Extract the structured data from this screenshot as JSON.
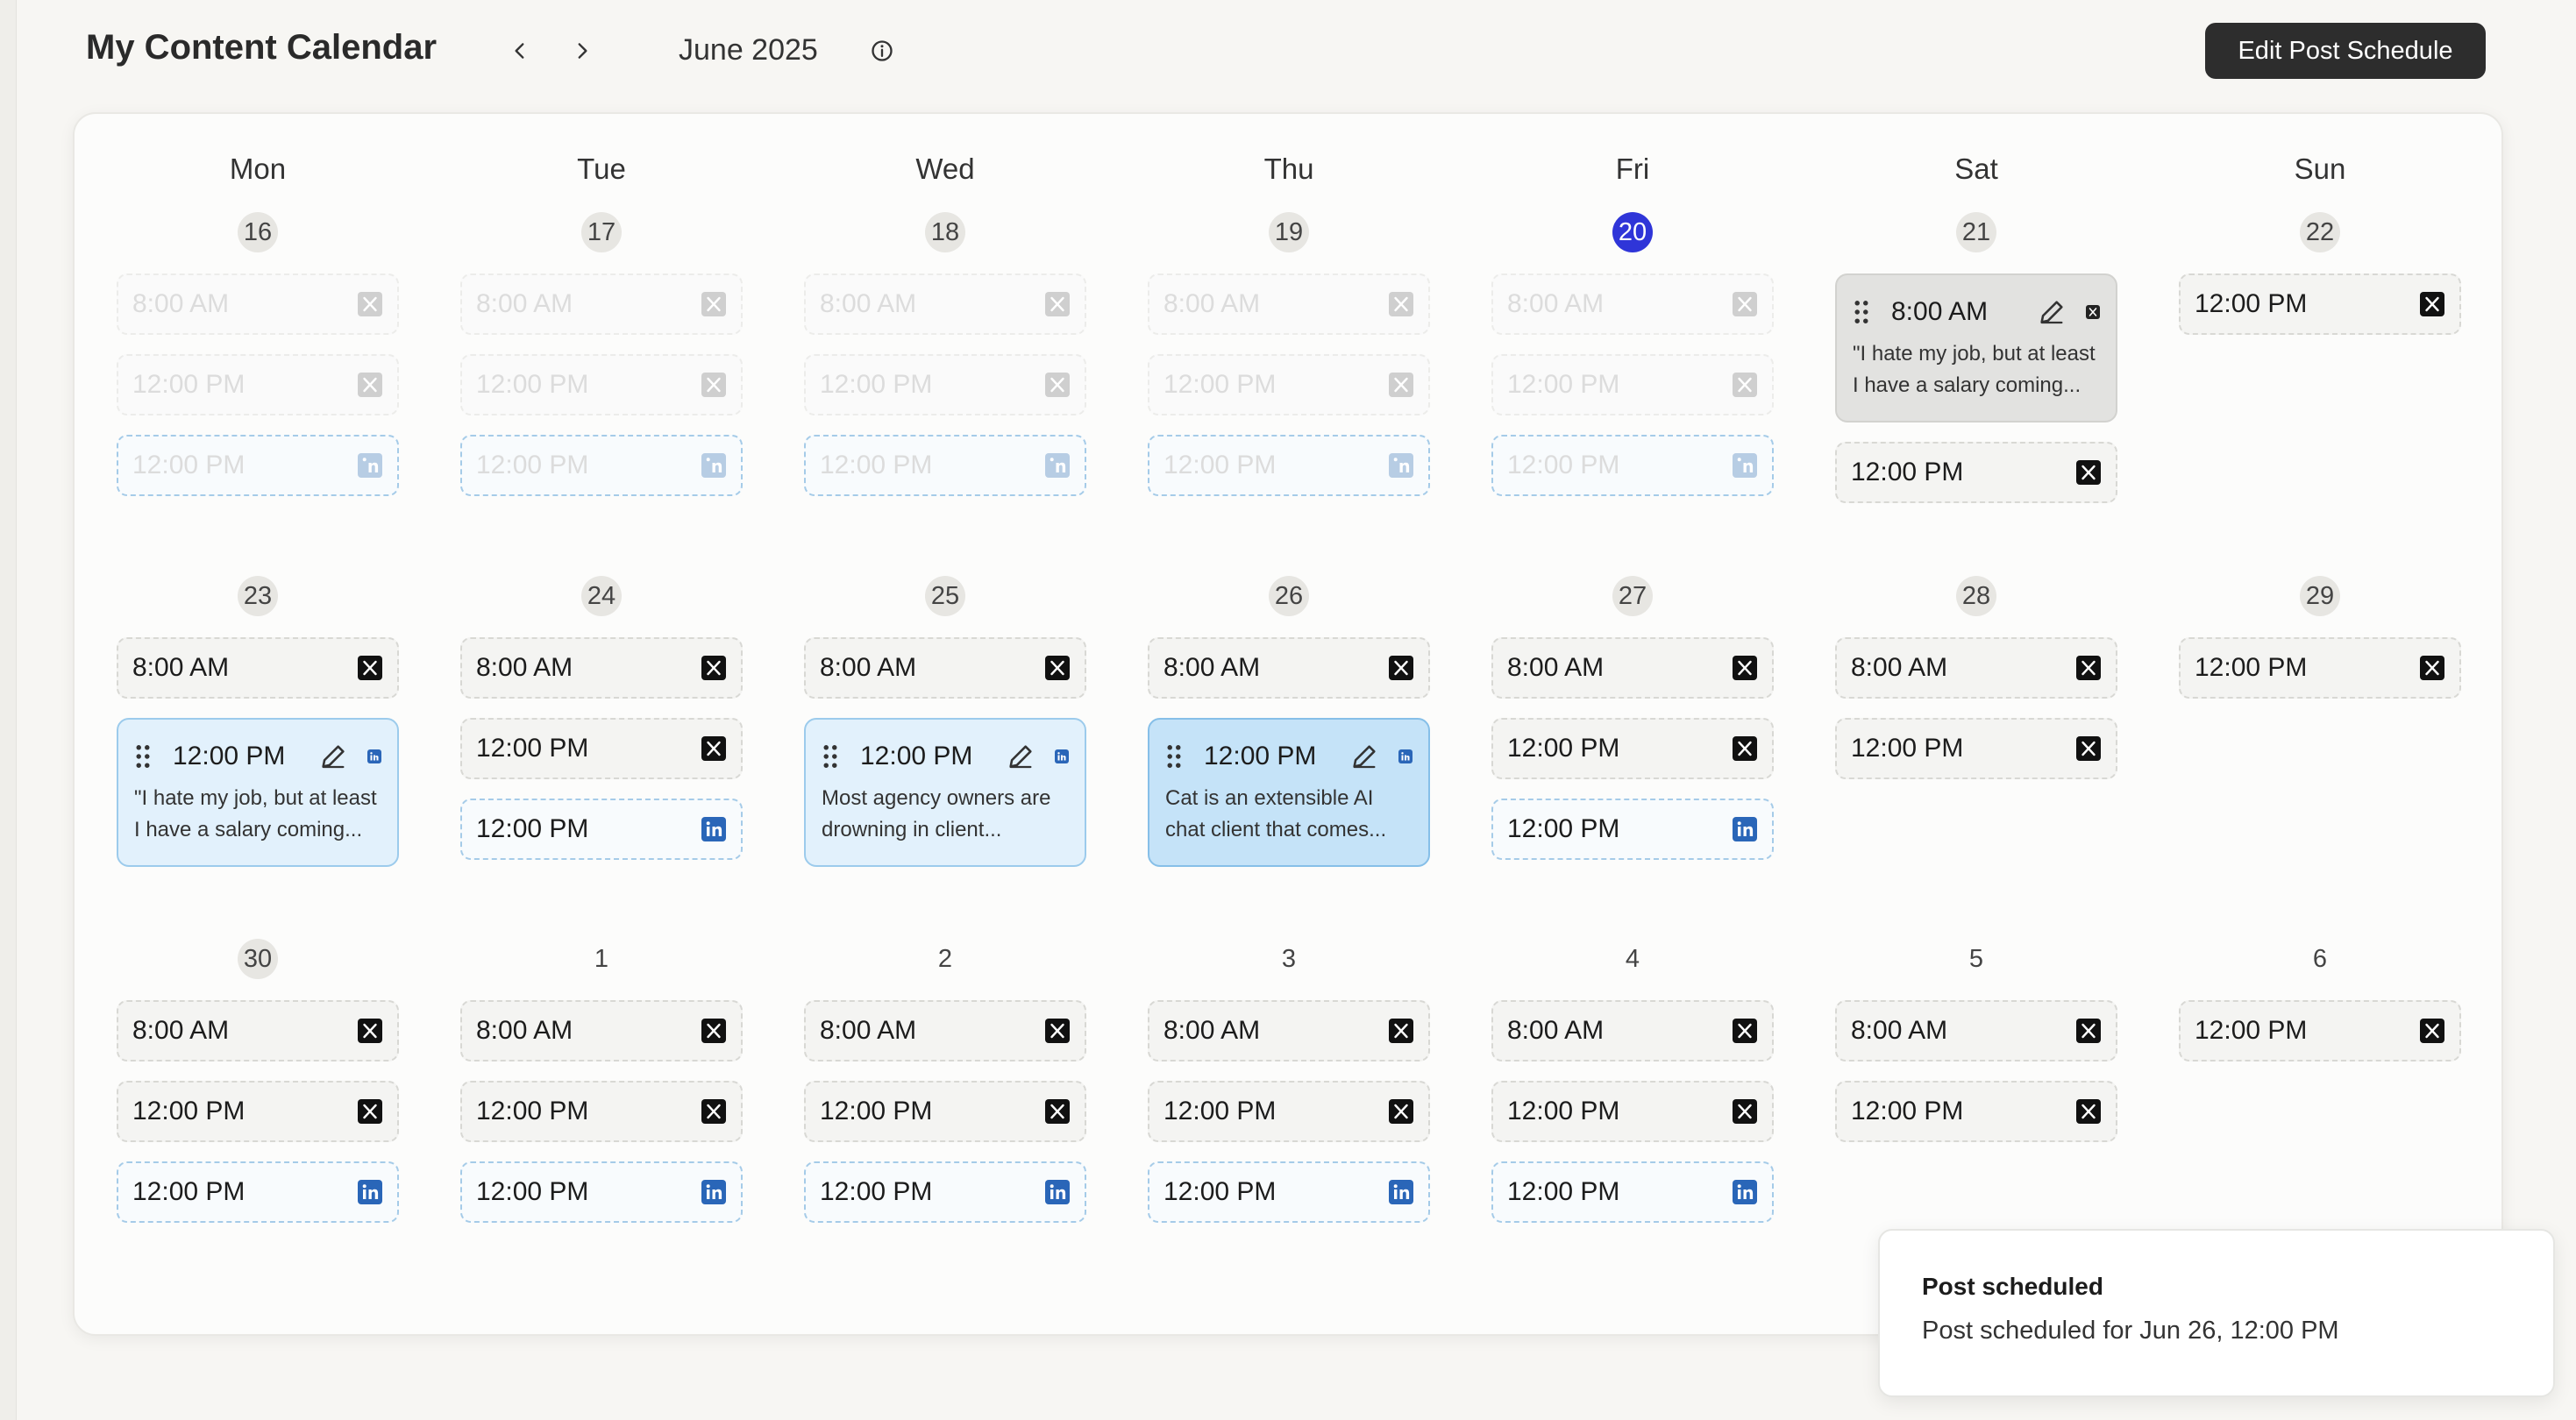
{
  "header": {
    "title": "My Content Calendar",
    "month": "June 2025",
    "edit_button": "Edit Post Schedule"
  },
  "weekdays": [
    "Mon",
    "Tue",
    "Wed",
    "Thu",
    "Fri",
    "Sat",
    "Sun"
  ],
  "weeks": [
    {
      "days": [
        {
          "num": "16",
          "style": "past",
          "items": [
            {
              "kind": "slot",
              "time": "8:00 AM",
              "net": "x",
              "faded": true
            },
            {
              "kind": "slot",
              "time": "12:00 PM",
              "net": "x",
              "faded": true
            },
            {
              "kind": "slot",
              "time": "12:00 PM",
              "net": "li",
              "faded": true
            }
          ]
        },
        {
          "num": "17",
          "style": "past",
          "items": [
            {
              "kind": "slot",
              "time": "8:00 AM",
              "net": "x",
              "faded": true
            },
            {
              "kind": "slot",
              "time": "12:00 PM",
              "net": "x",
              "faded": true
            },
            {
              "kind": "slot",
              "time": "12:00 PM",
              "net": "li",
              "faded": true
            }
          ]
        },
        {
          "num": "18",
          "style": "past",
          "items": [
            {
              "kind": "slot",
              "time": "8:00 AM",
              "net": "x",
              "faded": true
            },
            {
              "kind": "slot",
              "time": "12:00 PM",
              "net": "x",
              "faded": true
            },
            {
              "kind": "slot",
              "time": "12:00 PM",
              "net": "li",
              "faded": true
            }
          ]
        },
        {
          "num": "19",
          "style": "past",
          "items": [
            {
              "kind": "slot",
              "time": "8:00 AM",
              "net": "x",
              "faded": true
            },
            {
              "kind": "slot",
              "time": "12:00 PM",
              "net": "x",
              "faded": true
            },
            {
              "kind": "slot",
              "time": "12:00 PM",
              "net": "li",
              "faded": true
            }
          ]
        },
        {
          "num": "20",
          "style": "today",
          "items": [
            {
              "kind": "slot",
              "time": "8:00 AM",
              "net": "x",
              "faded": true
            },
            {
              "kind": "slot",
              "time": "12:00 PM",
              "net": "x",
              "faded": true
            },
            {
              "kind": "slot",
              "time": "12:00 PM",
              "net": "li",
              "faded": true
            }
          ]
        },
        {
          "num": "21",
          "style": "past",
          "items": [
            {
              "kind": "post",
              "time": "8:00 AM",
              "tone": "gray",
              "text": "\"I hate my job, but at least I have a salary coming..."
            },
            {
              "kind": "slot",
              "time": "12:00 PM",
              "net": "x"
            }
          ]
        },
        {
          "num": "22",
          "style": "past",
          "items": [
            {
              "kind": "slot",
              "time": "12:00 PM",
              "net": "x"
            }
          ]
        }
      ]
    },
    {
      "days": [
        {
          "num": "23",
          "style": "past",
          "items": [
            {
              "kind": "slot",
              "time": "8:00 AM",
              "net": "x"
            },
            {
              "kind": "post",
              "time": "12:00 PM",
              "tone": "lightblue",
              "text": "\"I hate my job, but at least I have a salary coming..."
            }
          ]
        },
        {
          "num": "24",
          "style": "past",
          "items": [
            {
              "kind": "slot",
              "time": "8:00 AM",
              "net": "x"
            },
            {
              "kind": "slot",
              "time": "12:00 PM",
              "net": "x"
            },
            {
              "kind": "slot",
              "time": "12:00 PM",
              "net": "li"
            }
          ]
        },
        {
          "num": "25",
          "style": "past",
          "items": [
            {
              "kind": "slot",
              "time": "8:00 AM",
              "net": "x"
            },
            {
              "kind": "post",
              "time": "12:00 PM",
              "tone": "lightblue",
              "text": "Most agency owners are drowning in client..."
            }
          ]
        },
        {
          "num": "26",
          "style": "past",
          "items": [
            {
              "kind": "slot",
              "time": "8:00 AM",
              "net": "x"
            },
            {
              "kind": "post",
              "time": "12:00 PM",
              "tone": "blue",
              "text": "Cat is an extensible AI chat client that comes..."
            }
          ]
        },
        {
          "num": "27",
          "style": "past",
          "items": [
            {
              "kind": "slot",
              "time": "8:00 AM",
              "net": "x"
            },
            {
              "kind": "slot",
              "time": "12:00 PM",
              "net": "x"
            },
            {
              "kind": "slot",
              "time": "12:00 PM",
              "net": "li"
            }
          ]
        },
        {
          "num": "28",
          "style": "past",
          "items": [
            {
              "kind": "slot",
              "time": "8:00 AM",
              "net": "x"
            },
            {
              "kind": "slot",
              "time": "12:00 PM",
              "net": "x"
            }
          ]
        },
        {
          "num": "29",
          "style": "past",
          "items": [
            {
              "kind": "slot",
              "time": "12:00 PM",
              "net": "x"
            }
          ]
        }
      ]
    },
    {
      "days": [
        {
          "num": "30",
          "style": "past",
          "items": [
            {
              "kind": "slot",
              "time": "8:00 AM",
              "net": "x"
            },
            {
              "kind": "slot",
              "time": "12:00 PM",
              "net": "x"
            },
            {
              "kind": "slot",
              "time": "12:00 PM",
              "net": "li"
            }
          ]
        },
        {
          "num": "1",
          "style": "plain",
          "items": [
            {
              "kind": "slot",
              "time": "8:00 AM",
              "net": "x"
            },
            {
              "kind": "slot",
              "time": "12:00 PM",
              "net": "x"
            },
            {
              "kind": "slot",
              "time": "12:00 PM",
              "net": "li"
            }
          ]
        },
        {
          "num": "2",
          "style": "plain",
          "items": [
            {
              "kind": "slot",
              "time": "8:00 AM",
              "net": "x"
            },
            {
              "kind": "slot",
              "time": "12:00 PM",
              "net": "x"
            },
            {
              "kind": "slot",
              "time": "12:00 PM",
              "net": "li"
            }
          ]
        },
        {
          "num": "3",
          "style": "plain",
          "items": [
            {
              "kind": "slot",
              "time": "8:00 AM",
              "net": "x"
            },
            {
              "kind": "slot",
              "time": "12:00 PM",
              "net": "x"
            },
            {
              "kind": "slot",
              "time": "12:00 PM",
              "net": "li"
            }
          ]
        },
        {
          "num": "4",
          "style": "plain",
          "items": [
            {
              "kind": "slot",
              "time": "8:00 AM",
              "net": "x"
            },
            {
              "kind": "slot",
              "time": "12:00 PM",
              "net": "x"
            },
            {
              "kind": "slot",
              "time": "12:00 PM",
              "net": "li"
            }
          ]
        },
        {
          "num": "5",
          "style": "plain",
          "items": [
            {
              "kind": "slot",
              "time": "8:00 AM",
              "net": "x"
            },
            {
              "kind": "slot",
              "time": "12:00 PM",
              "net": "x"
            }
          ]
        },
        {
          "num": "6",
          "style": "plain",
          "items": [
            {
              "kind": "slot",
              "time": "12:00 PM",
              "net": "x"
            }
          ]
        }
      ]
    }
  ],
  "toast": {
    "title": "Post scheduled",
    "body": "Post scheduled for Jun 26, 12:00 PM"
  },
  "icons": {
    "prev": "chevron-left-icon",
    "next": "chevron-right-icon",
    "info": "info-icon",
    "x": "x-logo-icon",
    "linkedin": "linkedin-icon",
    "edit": "pencil-icon",
    "drag": "drag-handle-icon"
  },
  "colors": {
    "today": "#2f35d8",
    "linkedin": "#2a66b8",
    "post_blue": "#c5e3f8",
    "post_lightblue": "#e2f1fc",
    "button_dark": "#2d2d2d"
  }
}
